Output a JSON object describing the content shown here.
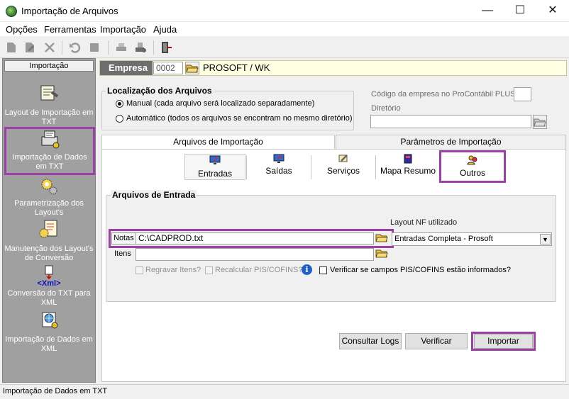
{
  "window": {
    "title": "Importação de Arquivos",
    "minimize": "—",
    "maximize": "☐",
    "close": "✕"
  },
  "menu": [
    {
      "label": "Opções"
    },
    {
      "label": "Ferramentas"
    },
    {
      "label": "Importação"
    },
    {
      "label": "Ajuda"
    }
  ],
  "sidebar": {
    "header": "Importação",
    "items": [
      {
        "label": "Layout de Importação em TXT",
        "icon": "scroll-hammer-icon"
      },
      {
        "label": "Importação de Dados em TXT",
        "icon": "printer-document-icon",
        "selected": true
      },
      {
        "label": "Parametrização dos Layout's",
        "icon": "gears-icon"
      },
      {
        "label": "Manutenção dos Layout's de Conversão",
        "icon": "document-gear-icon"
      },
      {
        "label": "Conversão do TXT para XML",
        "icon": "xml-convert-icon",
        "badge": "<Xml>"
      },
      {
        "label": "Importação de Dados em XML",
        "icon": "globe-document-icon"
      }
    ]
  },
  "empresa": {
    "label": "Empresa",
    "code": "0002",
    "name": "PROSOFT / WK"
  },
  "localizacao": {
    "title": "Localização dos Arquivos",
    "options": [
      {
        "label": "Manual (cada arquivo será localizado separadamente)",
        "selected": true
      },
      {
        "label": "Automático (todos os arquivos se encontram no mesmo diretório)",
        "selected": false
      }
    ]
  },
  "procontabil": {
    "code_label": "Código da empresa no ProContábil PLUS",
    "code_value": "",
    "dir_label": "Diretório",
    "dir_value": ""
  },
  "tabs": [
    {
      "label": "Arquivos de Importação",
      "active": true
    },
    {
      "label": "Parâmetros de Importação",
      "active": false
    }
  ],
  "subtabs": [
    {
      "label": "Entradas",
      "icon": "monitor-in-icon",
      "active": true
    },
    {
      "label": "Saídas",
      "icon": "monitor-out-icon"
    },
    {
      "label": "Serviços",
      "icon": "wrench-icon"
    },
    {
      "label": "Mapa Resumo",
      "icon": "book-icon"
    },
    {
      "label": "Outros",
      "icon": "people-icon"
    }
  ],
  "entrada": {
    "title": "Arquivos de Entrada",
    "notas_label": "Notas",
    "notas_value": "C:\\CADPROD.txt",
    "itens_label": "Itens",
    "itens_value": "",
    "layout_label": "Layout NF utilizado",
    "layout_value": "Entradas Completa - Prosoft",
    "regravar_label": "Regravar Itens?",
    "recalcular_label": "Recalcular PIS/COFINS?",
    "verificar_label": "Verificar se campos PIS/COFINS estão informados?"
  },
  "buttons": {
    "consultar": "Consultar Logs",
    "verificar": "Verificar",
    "importar": "Importar"
  },
  "status": "Importação de Dados em TXT",
  "colors": {
    "highlight": "#9c3fa6",
    "empresa_bg": "#ffffe1"
  }
}
